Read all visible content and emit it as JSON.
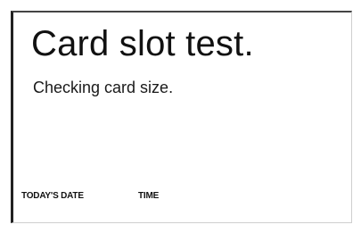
{
  "screen": {
    "title": "Card slot test.",
    "message": "Checking card size."
  },
  "footer": {
    "date_label": "TODAY'S DATE",
    "time_label": "TIME"
  }
}
